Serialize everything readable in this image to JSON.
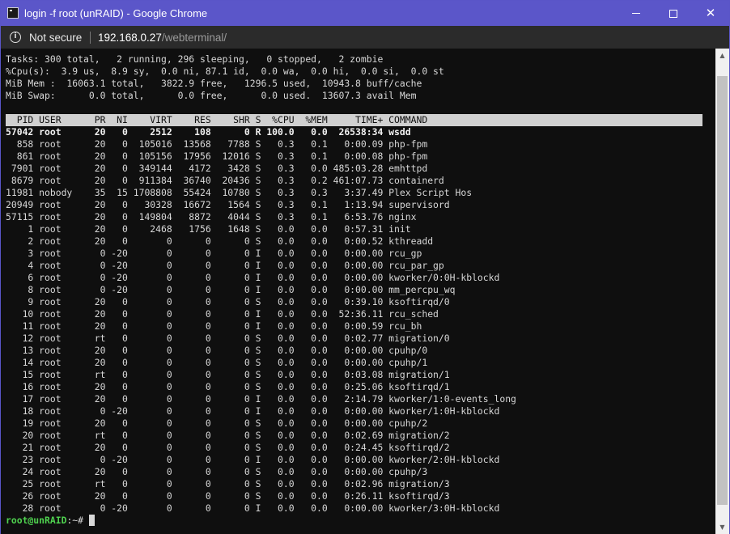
{
  "window": {
    "title": "login -f root (unRAID) - Google Chrome",
    "controls": {
      "minimize_icon": "minimize-icon",
      "maximize_icon": "maximize-icon",
      "close_icon": "close-icon",
      "close_glyph": "✕"
    }
  },
  "address_bar": {
    "security_label": "Not secure",
    "url_host": "192.168.0.27",
    "url_path": "/webterminal/"
  },
  "terminal": {
    "summary": [
      "Tasks: 300 total,   2 running, 296 sleeping,   0 stopped,   2 zombie",
      "%Cpu(s):  3.9 us,  8.9 sy,  0.0 ni, 87.1 id,  0.0 wa,  0.0 hi,  0.0 si,  0.0 st",
      "MiB Mem :  16063.1 total,   3822.9 free,   1296.5 used,  10943.8 buff/cache",
      "MiB Swap:      0.0 total,      0.0 free,      0.0 used.  13607.3 avail Mem"
    ],
    "columns": [
      "PID",
      "USER",
      "PR",
      "NI",
      "VIRT",
      "RES",
      "SHR",
      "S",
      "%CPU",
      "%MEM",
      "TIME+",
      "COMMAND"
    ],
    "header_line": "  PID USER      PR  NI    VIRT    RES    SHR S  %CPU  %MEM     TIME+ COMMAND",
    "processes": [
      "57042 root      20   0    2512    108      0 R 100.0   0.0  26538:34 wsdd",
      "  858 root      20   0  105016  13568   7788 S   0.3   0.1   0:00.09 php-fpm",
      "  861 root      20   0  105156  17956  12016 S   0.3   0.1   0:00.08 php-fpm",
      " 7901 root      20   0  349144   4172   3428 S   0.3   0.0 485:03.28 emhttpd",
      " 8679 root      20   0  911384  36740  20436 S   0.3   0.2 461:07.73 containerd",
      "11981 nobody    35  15 1708808  55424  10780 S   0.3   0.3   3:37.49 Plex Script Hos",
      "20949 root      20   0   30328  16672   1564 S   0.3   0.1   1:13.94 supervisord",
      "57115 root      20   0  149804   8872   4044 S   0.3   0.1   6:53.76 nginx",
      "    1 root      20   0    2468   1756   1648 S   0.0   0.0   0:57.31 init",
      "    2 root      20   0       0      0      0 S   0.0   0.0   0:00.52 kthreadd",
      "    3 root       0 -20       0      0      0 I   0.0   0.0   0:00.00 rcu_gp",
      "    4 root       0 -20       0      0      0 I   0.0   0.0   0:00.00 rcu_par_gp",
      "    6 root       0 -20       0      0      0 I   0.0   0.0   0:00.00 kworker/0:0H-kblockd",
      "    8 root       0 -20       0      0      0 I   0.0   0.0   0:00.00 mm_percpu_wq",
      "    9 root      20   0       0      0      0 S   0.0   0.0   0:39.10 ksoftirqd/0",
      "   10 root      20   0       0      0      0 I   0.0   0.0  52:36.11 rcu_sched",
      "   11 root      20   0       0      0      0 I   0.0   0.0   0:00.59 rcu_bh",
      "   12 root      rt   0       0      0      0 S   0.0   0.0   0:02.77 migration/0",
      "   13 root      20   0       0      0      0 S   0.0   0.0   0:00.00 cpuhp/0",
      "   14 root      20   0       0      0      0 S   0.0   0.0   0:00.00 cpuhp/1",
      "   15 root      rt   0       0      0      0 S   0.0   0.0   0:03.08 migration/1",
      "   16 root      20   0       0      0      0 S   0.0   0.0   0:25.06 ksoftirqd/1",
      "   17 root      20   0       0      0      0 I   0.0   0.0   2:14.79 kworker/1:0-events_long",
      "   18 root       0 -20       0      0      0 I   0.0   0.0   0:00.00 kworker/1:0H-kblockd",
      "   19 root      20   0       0      0      0 S   0.0   0.0   0:00.00 cpuhp/2",
      "   20 root      rt   0       0      0      0 S   0.0   0.0   0:02.69 migration/2",
      "   21 root      20   0       0      0      0 S   0.0   0.0   0:24.45 ksoftirqd/2",
      "   23 root       0 -20       0      0      0 I   0.0   0.0   0:00.00 kworker/2:0H-kblockd",
      "   24 root      20   0       0      0      0 S   0.0   0.0   0:00.00 cpuhp/3",
      "   25 root      rt   0       0      0      0 S   0.0   0.0   0:02.96 migration/3",
      "   26 root      20   0       0      0      0 S   0.0   0.0   0:26.11 ksoftirqd/3",
      "   28 root       0 -20       0      0      0 I   0.0   0.0   0:00.00 kworker/3:0H-kblockd"
    ],
    "prompt_user": "root@unRAID",
    "prompt_rest": ":~#",
    "colors": {
      "prompt": "#4fd24f",
      "background": "#0f0f0f",
      "header_bar": "#d0d0d0",
      "titlebar": "#5b56c9"
    }
  }
}
